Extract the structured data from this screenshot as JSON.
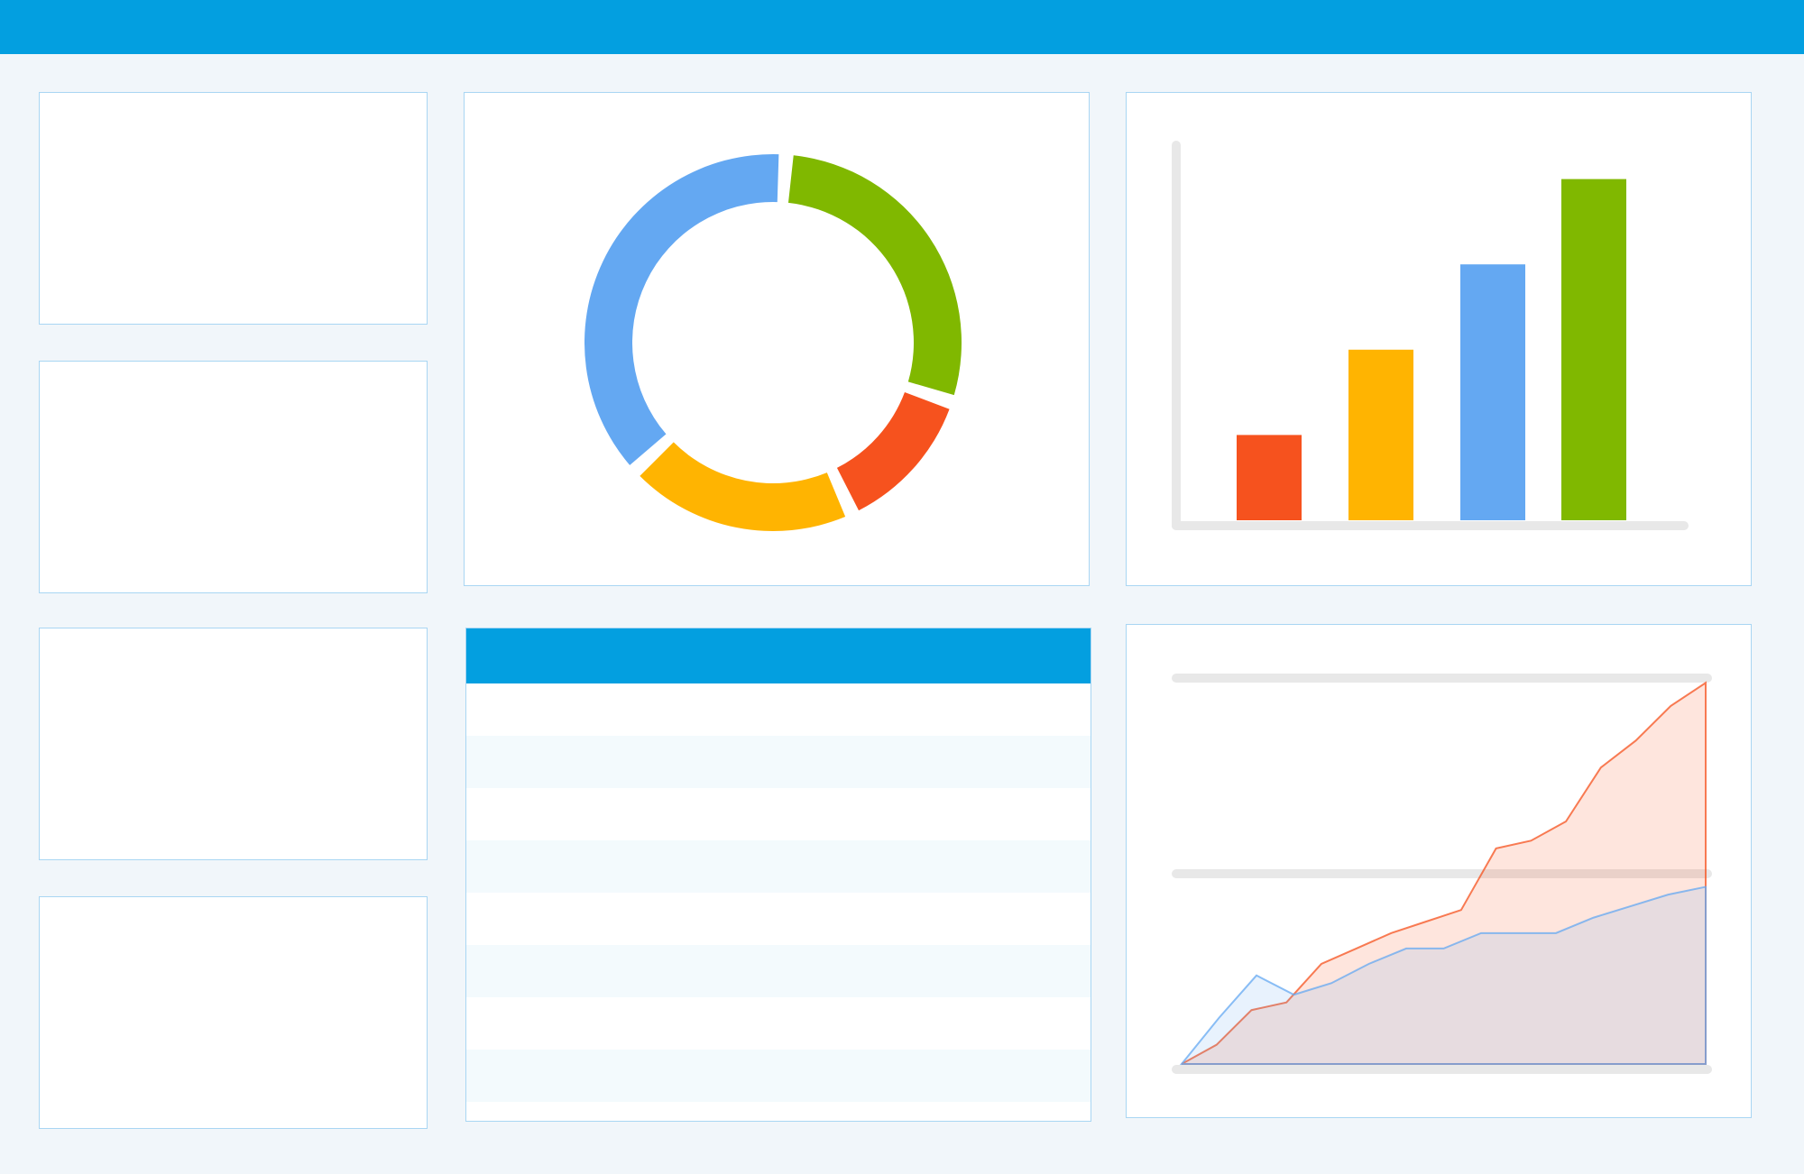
{
  "colors": {
    "header": "#039fe0",
    "background": "#f1f6fa",
    "card_border": "#a9d6f3",
    "row_alt": "#f3fafd",
    "blue": "#64a8f2",
    "green": "#80b800",
    "red": "#f6521e",
    "yellow": "#ffb401",
    "axis": "#e8e8e8"
  },
  "table": {
    "rows": 8
  },
  "chart_data": [
    {
      "type": "pie",
      "variant": "donut",
      "slices": [
        {
          "color": "#80b800",
          "value": 29
        },
        {
          "color": "#f6521e",
          "value": 13
        },
        {
          "color": "#ffb401",
          "value": 20
        },
        {
          "color": "#64a8f2",
          "value": 38
        }
      ]
    },
    {
      "type": "bar",
      "values": [
        12,
        24,
        36,
        48
      ],
      "colors": [
        "#f6521e",
        "#ffb401",
        "#64a8f2",
        "#80b800"
      ],
      "ylim": [
        0,
        60
      ],
      "grid": false
    },
    {
      "type": "area",
      "x": [
        0,
        1,
        2,
        3,
        4,
        5,
        6,
        7,
        8,
        9,
        10,
        11,
        12,
        13,
        14,
        15,
        16,
        17,
        18,
        19
      ],
      "ylim": [
        0,
        100
      ],
      "series": [
        {
          "color": "#f6521e",
          "values": [
            0,
            5,
            14,
            16,
            26,
            30,
            34,
            37,
            40,
            56,
            58,
            63,
            77,
            84,
            93,
            99
          ]
        },
        {
          "color": "#64a8f2",
          "values": [
            0,
            12,
            23,
            18,
            21,
            26,
            30,
            30,
            34,
            34,
            34,
            38,
            41,
            44,
            46
          ]
        }
      ]
    }
  ]
}
